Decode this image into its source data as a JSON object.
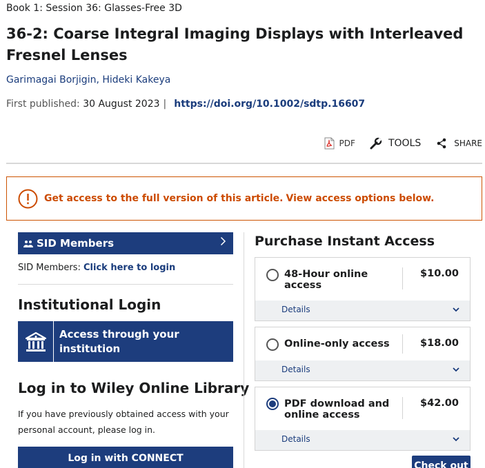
{
  "breadcrumb": "Book 1: Session 36: Glasses-Free 3D",
  "article": {
    "title": "36-2: Coarse Integral Imaging Displays with Interleaved Fresnel Lenses",
    "authors": [
      "Garimagai Borjigin",
      "Hideki Kakeya"
    ],
    "author_separator": ",",
    "first_published_label": "First published:",
    "first_published_date": "30 August 2023",
    "separator": "|",
    "doi": "https://doi.org/10.1002/sdtp.16607"
  },
  "toolbar": {
    "pdf_label": "PDF",
    "tools_label": "TOOLS",
    "share_label": "SHARE"
  },
  "alert": {
    "main": "Get access to the full version of this article.",
    "sub": "View access options below."
  },
  "sid": {
    "bar_label": "SID Members",
    "text_prefix": "SID Members:",
    "login_link": "Click here to login"
  },
  "institutional": {
    "heading": "Institutional Login",
    "button_label": "Access through your institution"
  },
  "wiley": {
    "heading": "Log in to Wiley Online Library",
    "text": "If you have previously obtained access with your personal account, please log in.",
    "button_label": "Log in with CONNECT"
  },
  "purchase": {
    "heading": "Purchase Instant Access",
    "options": [
      {
        "label": "48-Hour online access",
        "price": "$10.00",
        "details": "Details",
        "selected": false
      },
      {
        "label": "Online-only access",
        "price": "$18.00",
        "details": "Details",
        "selected": false
      },
      {
        "label": "PDF download and online access",
        "price": "$42.00",
        "details": "Details",
        "selected": true
      }
    ],
    "checkout_label": "Check out"
  },
  "colors": {
    "brand_navy": "#1d3d7d",
    "link": "#1a3c7c",
    "alert_orange": "#cc4b00",
    "details_bg": "#eef0f2"
  },
  "icons": [
    "pdf-icon",
    "wrench-icon",
    "share-icon",
    "info-icon",
    "people-icon",
    "chevron-right-icon",
    "bank-icon",
    "chevron-down-icon"
  ]
}
